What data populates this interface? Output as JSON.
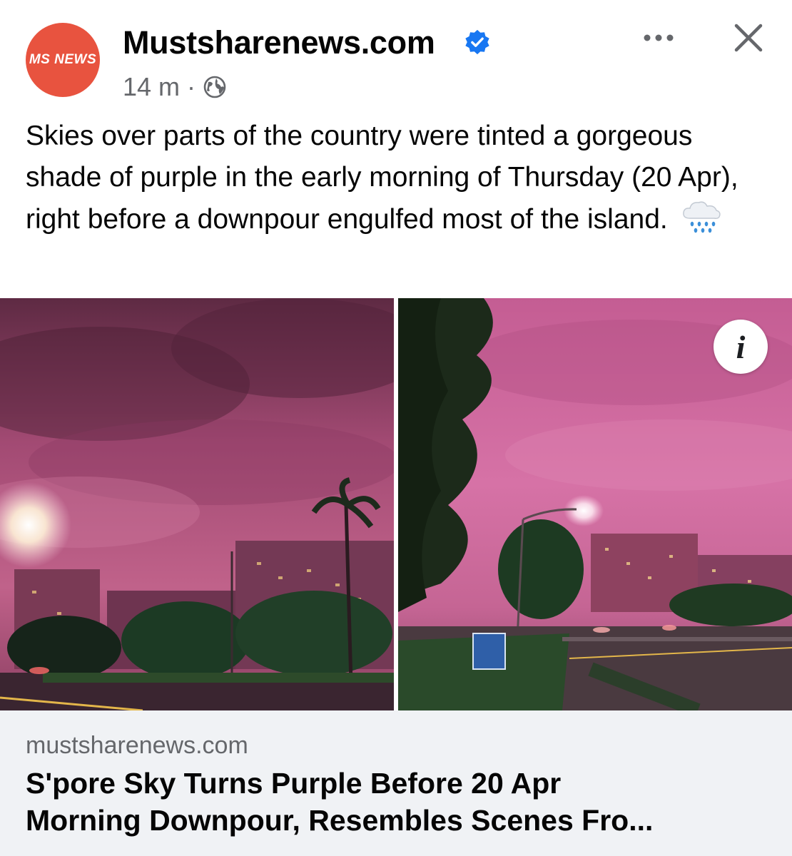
{
  "post": {
    "page_name": "Mustsharenews.com",
    "avatar_label": "MS NEWS",
    "timestamp": "14 m",
    "separator": "·",
    "text": "Skies over parts of the country were tinted a gorgeous shade of purple in the early morning of Thursday (20 Apr), right before a downpour engulfed most of the island.",
    "icons": {
      "verified": "verified-badge-icon",
      "audience": "globe-icon",
      "more": "more-options-icon",
      "close": "close-icon",
      "emoji": "cloud-with-rain-icon",
      "info": "info-icon"
    }
  },
  "info_button": {
    "glyph": "i"
  },
  "link_preview": {
    "domain": "mustsharenews.com",
    "title": "S'pore Sky Turns Purple Before 20 Apr\nMorning Downpour, Resembles Scenes Fro..."
  },
  "colors": {
    "avatar_bg": "#e8533f",
    "verified_blue": "#1877f2",
    "meta_gray": "#65676b",
    "preview_bg": "#f0f2f5",
    "sky_purple": "#b0507e"
  }
}
